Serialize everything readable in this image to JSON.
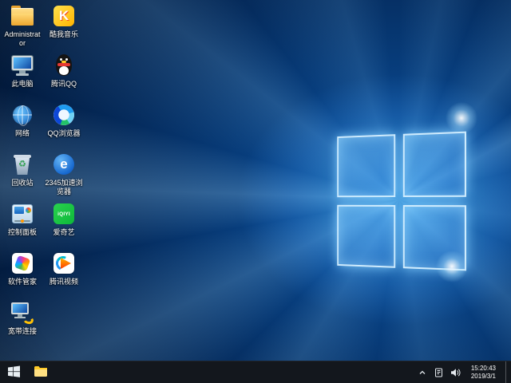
{
  "desktop": {
    "icons": [
      {
        "label": "Administrator",
        "icon": "user-folder-icon"
      },
      {
        "label": "此电脑",
        "icon": "this-pc-icon"
      },
      {
        "label": "网络",
        "icon": "network-globe-icon"
      },
      {
        "label": "回收站",
        "icon": "recycle-bin-icon"
      },
      {
        "label": "控制面板",
        "icon": "control-panel-icon"
      },
      {
        "label": "软件管家",
        "icon": "software-manager-icon"
      },
      {
        "label": "宽带连接",
        "icon": "broadband-connection-icon"
      },
      {
        "label": "酷我音乐",
        "icon": "kuwo-music-icon"
      },
      {
        "label": "腾讯QQ",
        "icon": "tencent-qq-icon"
      },
      {
        "label": "QQ浏览器",
        "icon": "qq-browser-icon"
      },
      {
        "label": "2345加速浏览器",
        "icon": "2345-browser-icon"
      },
      {
        "label": "爱奇艺",
        "icon": "iqiyi-icon"
      },
      {
        "label": "腾讯视频",
        "icon": "tencent-video-icon"
      }
    ]
  },
  "taskbar": {
    "time": "15:20:43",
    "date": "2019/3/1",
    "tray_icons": [
      "chevron-up-icon",
      "notes-icon",
      "volume-icon"
    ],
    "buttons": [
      "start-button",
      "file-explorer-button"
    ]
  },
  "colors": {
    "taskbar_bg": "#13171d",
    "wallpaper_accent": "#0d59a8",
    "glow": "#5fc3ff"
  }
}
